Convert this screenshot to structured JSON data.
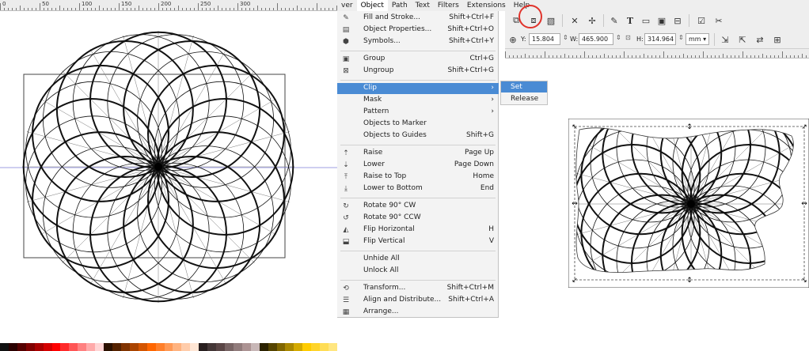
{
  "menubar": {
    "items": [
      {
        "label": "ver",
        "active": false
      },
      {
        "label": "Object",
        "active": true
      },
      {
        "label": "Path",
        "active": false
      },
      {
        "label": "Text",
        "active": false
      },
      {
        "label": "Filters",
        "active": false
      },
      {
        "label": "Extensions",
        "active": false
      },
      {
        "label": "Help",
        "active": false
      }
    ]
  },
  "left_ruler": {
    "labels": [
      "0",
      "50",
      "100",
      "150",
      "200",
      "250",
      "300"
    ]
  },
  "toolbar": {
    "x_label": "Y:",
    "x_value": "15.804",
    "w_label": "W:",
    "w_value": "465.900",
    "h_label": "H:",
    "h_value": "314.964",
    "unit": "mm"
  },
  "object_menu": {
    "items": [
      {
        "icon": "fill-stroke-icon",
        "glyph": "✎",
        "label": "Fill and Stroke...",
        "shortcut": "Shift+Ctrl+F",
        "arrow": ""
      },
      {
        "icon": "object-properties-icon",
        "glyph": "▤",
        "label": "Object Properties...",
        "shortcut": "Shift+Ctrl+O",
        "arrow": ""
      },
      {
        "icon": "symbols-icon",
        "glyph": "⬢",
        "label": "Symbols...",
        "shortcut": "Shift+Ctrl+Y",
        "arrow": ""
      },
      {
        "sep": true
      },
      {
        "icon": "group-icon",
        "glyph": "▣",
        "label": "Group",
        "shortcut": "Ctrl+G",
        "arrow": ""
      },
      {
        "icon": "ungroup-icon",
        "glyph": "⊠",
        "label": "Ungroup",
        "shortcut": "Shift+Ctrl+G",
        "arrow": ""
      },
      {
        "sep": true
      },
      {
        "icon": "",
        "glyph": "",
        "label": "Clip",
        "shortcut": "",
        "arrow": "›",
        "selected": true
      },
      {
        "icon": "",
        "glyph": "",
        "label": "Mask",
        "shortcut": "",
        "arrow": "›"
      },
      {
        "icon": "",
        "glyph": "",
        "label": "Pattern",
        "shortcut": "",
        "arrow": "›"
      },
      {
        "icon": "",
        "glyph": "",
        "label": "Objects to Marker",
        "shortcut": "",
        "arrow": ""
      },
      {
        "icon": "",
        "glyph": "",
        "label": "Objects to Guides",
        "shortcut": "Shift+G",
        "arrow": ""
      },
      {
        "sep": true
      },
      {
        "icon": "raise-icon",
        "glyph": "⇡",
        "label": "Raise",
        "shortcut": "Page Up",
        "arrow": ""
      },
      {
        "icon": "lower-icon",
        "glyph": "⇣",
        "label": "Lower",
        "shortcut": "Page Down",
        "arrow": ""
      },
      {
        "icon": "raise-to-top-icon",
        "glyph": "⤒",
        "label": "Raise to Top",
        "shortcut": "Home",
        "arrow": ""
      },
      {
        "icon": "lower-to-bottom-icon",
        "glyph": "⤓",
        "label": "Lower to Bottom",
        "shortcut": "End",
        "arrow": ""
      },
      {
        "sep": true
      },
      {
        "icon": "rotate-cw-icon",
        "glyph": "↻",
        "label": "Rotate 90° CW",
        "shortcut": "",
        "arrow": ""
      },
      {
        "icon": "rotate-ccw-icon",
        "glyph": "↺",
        "label": "Rotate 90° CCW",
        "shortcut": "",
        "arrow": ""
      },
      {
        "icon": "flip-horizontal-icon",
        "glyph": "◭",
        "label": "Flip Horizontal",
        "shortcut": "H",
        "arrow": ""
      },
      {
        "icon": "flip-vertical-icon",
        "glyph": "⬓",
        "label": "Flip Vertical",
        "shortcut": "V",
        "arrow": ""
      },
      {
        "sep": true
      },
      {
        "icon": "",
        "glyph": "",
        "label": "Unhide All",
        "shortcut": "",
        "arrow": ""
      },
      {
        "icon": "",
        "glyph": "",
        "label": "Unlock All",
        "shortcut": "",
        "arrow": ""
      },
      {
        "sep": true
      },
      {
        "icon": "transform-icon",
        "glyph": "⟲",
        "label": "Transform...",
        "shortcut": "Shift+Ctrl+M",
        "arrow": ""
      },
      {
        "icon": "align-distribute-icon",
        "glyph": "☰",
        "label": "Align and Distribute...",
        "shortcut": "Shift+Ctrl+A",
        "arrow": ""
      },
      {
        "icon": "arrange-icon",
        "glyph": "▦",
        "label": "Arrange...",
        "shortcut": "",
        "arrow": ""
      }
    ]
  },
  "submenu": {
    "items": [
      {
        "label": "Set",
        "selected": true
      },
      {
        "label": "Release",
        "selected": false
      }
    ]
  },
  "palette": [
    "#111111",
    "#2a0000",
    "#550000",
    "#800000",
    "#aa0000",
    "#d40000",
    "#ff0000",
    "#ff2a2a",
    "#ff5555",
    "#ff8080",
    "#ffaaaa",
    "#ffd5d5",
    "#2b1100",
    "#552200",
    "#803300",
    "#aa4400",
    "#d45500",
    "#ff6600",
    "#ff7f2a",
    "#ff9955",
    "#ffb380",
    "#ffccaa",
    "#ffe6d5",
    "#281f1f",
    "#443737",
    "#5a4646",
    "#786464",
    "#917c7c",
    "#ac9393",
    "#c8b7b7",
    "#2b2200",
    "#554400",
    "#806600",
    "#aa8800",
    "#d4aa00",
    "#ffcc00",
    "#ffd42a",
    "#ffdd55",
    "#ffe680"
  ],
  "colors": {
    "menu_highlight": "#4a8bd4",
    "highlight_circle": "#e0332b",
    "guide_line": "#7b7bd8"
  }
}
